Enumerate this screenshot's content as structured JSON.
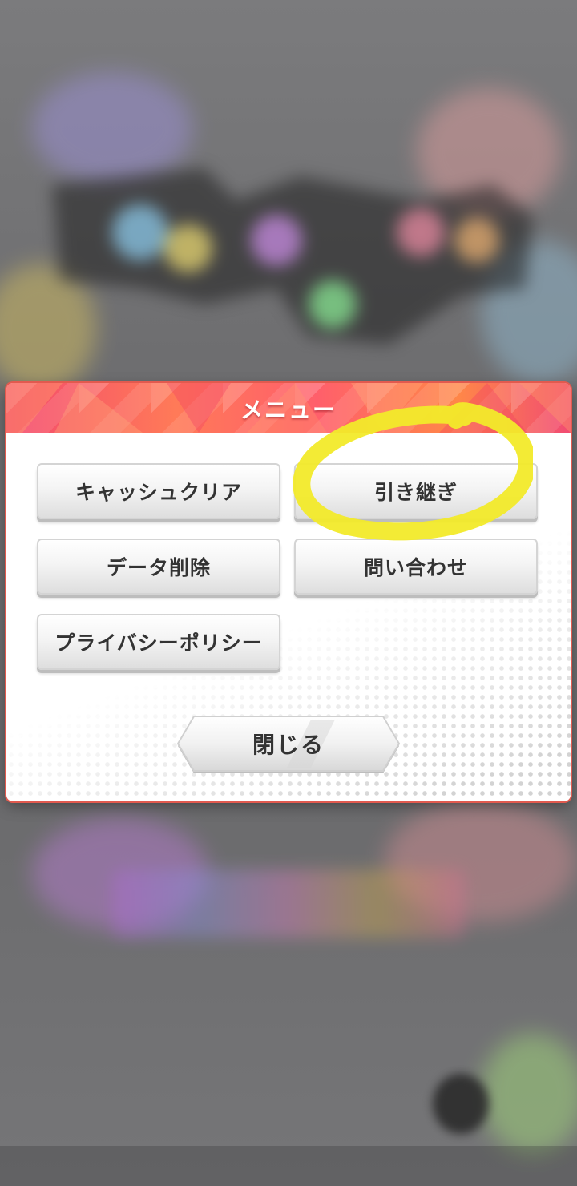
{
  "dialog": {
    "title": "メニュー",
    "buttons": {
      "cache_clear": "キャッシュクリア",
      "transfer": "引き継ぎ",
      "delete_data": "データ削除",
      "contact": "問い合わせ",
      "privacy_policy": "プライバシーポリシー"
    },
    "close_label": "閉じる"
  },
  "colors": {
    "header_accent": "#f44a6d",
    "annotation": "#f2ea2a"
  }
}
